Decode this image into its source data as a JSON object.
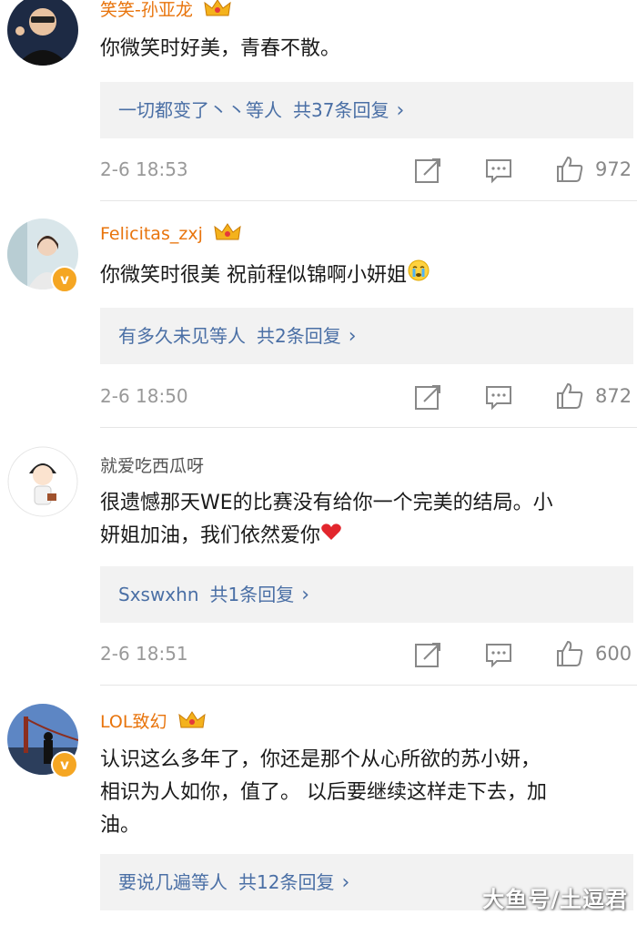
{
  "comments": [
    {
      "username": "笑笑-孙亚龙",
      "body": "你微笑时好美，青春不散。",
      "reply_names": "一切都变了丶丶等人",
      "reply_count": "共37条回复",
      "time": "2-6 18:53",
      "likes": "972"
    },
    {
      "username": "Felicitas_zxj",
      "body": "你微笑时很美 祝前程似锦啊小妍姐",
      "reply_names": "有多久未见等人",
      "reply_count": "共2条回复",
      "time": "2-6 18:50",
      "likes": "872"
    },
    {
      "username": "就爱吃西瓜呀",
      "body_line1": "很遗憾那天WE的比赛没有给你一个完美的结局。小",
      "body_line2": "妍姐加油，我们依然爱你",
      "reply_names": "Sxswxhn",
      "reply_count": "共1条回复",
      "time": "2-6 18:51",
      "likes": "600"
    },
    {
      "username": "LOL致幻",
      "body_line1": "认识这么多年了，你还是那个从心所欲的苏小妍，",
      "body_line2": "相识为人如你，值了。 以后要继续这样走下去，加",
      "body_line3": "油。",
      "reply_names": "要说几遍等人",
      "reply_count": "共12条回复"
    }
  ],
  "watermark": "大鱼号/土逗君",
  "colors": {
    "vip_name": "#e8740c",
    "link": "#4a6fa5",
    "meta": "#999999",
    "reply_bg": "#f2f2f2",
    "badge": "#f5a623"
  },
  "icons": [
    "crown-icon",
    "verified-badge-icon",
    "share-icon",
    "comment-icon",
    "like-icon",
    "crying-emoji-icon",
    "heart-emoji-icon"
  ]
}
